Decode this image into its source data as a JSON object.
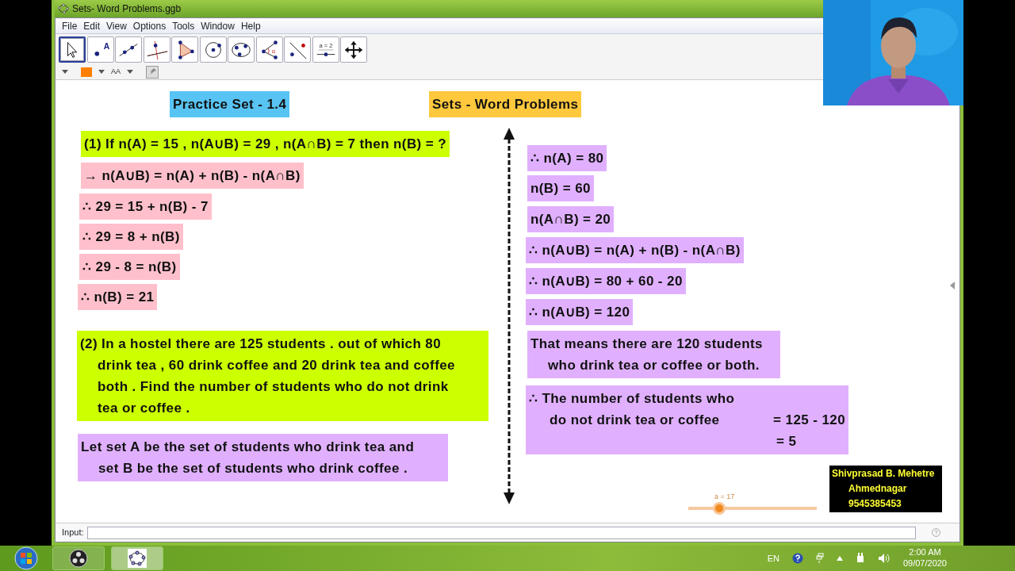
{
  "window": {
    "title": "Sets- Word Problems.ggb"
  },
  "menu": [
    "File",
    "Edit",
    "View",
    "Options",
    "Tools",
    "Window",
    "Help"
  ],
  "tools": [
    {
      "kind": "move",
      "selected": true
    },
    {
      "kind": "point",
      "label": "A",
      "selected": false
    },
    {
      "kind": "line",
      "selected": false
    },
    {
      "kind": "perpendicular",
      "selected": false
    },
    {
      "kind": "polygon",
      "selected": false
    },
    {
      "kind": "circle",
      "selected": false
    },
    {
      "kind": "conic",
      "selected": false
    },
    {
      "kind": "angle",
      "label": "α",
      "selected": false
    },
    {
      "kind": "reflect",
      "selected": false
    },
    {
      "kind": "slider",
      "label": "a = 2",
      "selected": false
    },
    {
      "kind": "pan",
      "selected": false
    }
  ],
  "style_bar": {
    "color": "#ff7f00",
    "text_size_label": "AA"
  },
  "boxes": [
    {
      "kind": "heading",
      "text": "Practice Set - 1.4",
      "color": "#58c4f3"
    },
    {
      "kind": "heading",
      "text": "Sets - Word Problems",
      "color": "#ffc83d"
    },
    {
      "kind": "line",
      "text": "(1) If n(A) = 15 , n(A∪B) = 29 ,  n(A∩B) = 7 then n(B) = ?",
      "color": "#ccff00"
    },
    {
      "kind": "line",
      "text": "→ n(A∪B) = n(A) + n(B) - n(A∩B)",
      "color": "#ffc0cb"
    },
    {
      "kind": "line",
      "text": "∴ 29 = 15 + n(B) - 7",
      "color": "#ffc0cb"
    },
    {
      "kind": "line",
      "text": "∴ 29 = 8 + n(B)",
      "color": "#ffc0cb"
    },
    {
      "kind": "line",
      "text": "∴ 29 - 8 = n(B)",
      "color": "#ffc0cb"
    },
    {
      "kind": "line",
      "text": "∴ n(B) = 21",
      "color": "#ffc0cb"
    },
    {
      "kind": "para",
      "lines": [
        "(2) In a hostel there are 125 students . out of which 80",
        "drink tea , 60 drink coffee and 20 drink tea and coffee",
        "both . Find the number of students who do not drink",
        "tea or coffee ."
      ],
      "color": "#ccff00"
    },
    {
      "kind": "para",
      "lines": [
        "Let set A be the set of students who drink tea and",
        "set B be the set of students who drink coffee ."
      ],
      "color": "#e0b0ff"
    },
    {
      "kind": "line",
      "text": "∴ n(A) = 80",
      "color": "#e0b0ff"
    },
    {
      "kind": "line",
      "text": "n(B) = 60",
      "color": "#e0b0ff"
    },
    {
      "kind": "line",
      "text": "n(A∩B) = 20",
      "color": "#e0b0ff"
    },
    {
      "kind": "line",
      "text": "∴ n(A∪B) = n(A) + n(B) - n(A∩B)",
      "color": "#e0b0ff"
    },
    {
      "kind": "line",
      "text": "∴ n(A∪B) = 80 + 60 - 20",
      "color": "#e0b0ff"
    },
    {
      "kind": "line",
      "text": "∴ n(A∪B) = 120",
      "color": "#e0b0ff"
    },
    {
      "kind": "para",
      "lines": [
        "That means there are 120 students",
        "who drink tea or coffee or both."
      ],
      "color": "#e0b0ff"
    },
    {
      "kind": "result",
      "lines": [
        "∴ The number of students who",
        "do not drink tea or coffee"
      ],
      "results": [
        "= 125 - 120",
        "= 5"
      ],
      "color": "#e0b0ff"
    }
  ],
  "slider": {
    "label": "a = 17",
    "level": 0.24
  },
  "name_card": [
    "Shivprasad B. Mehetre",
    "Ahmednagar",
    "9545385453"
  ],
  "input_bar": {
    "label": "Input:"
  },
  "taskbar": {
    "language": "EN",
    "time": "2:00 AM",
    "date": "09/07/2020"
  },
  "webcam": {
    "kind": "picture"
  }
}
